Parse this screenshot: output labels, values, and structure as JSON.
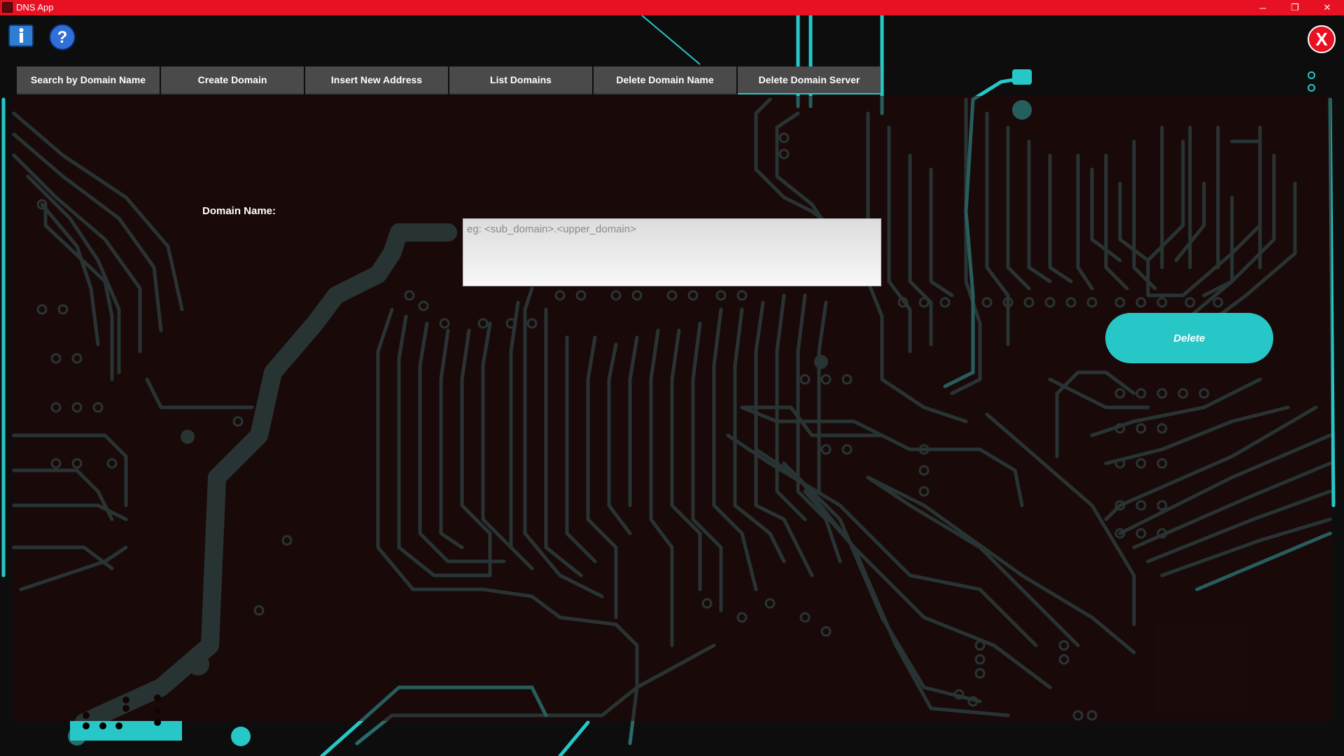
{
  "window": {
    "title": "DNS App",
    "controls": {
      "minimize": "─",
      "maximize": "❐",
      "close": "✕"
    }
  },
  "toolbar": {
    "info_icon": "info-icon",
    "help_icon": "help-icon",
    "close_label": "X"
  },
  "tabs": [
    {
      "label": "Search by Domain Name"
    },
    {
      "label": "Create Domain"
    },
    {
      "label": "Insert New Address"
    },
    {
      "label": "List Domains"
    },
    {
      "label": "Delete Domain Name"
    },
    {
      "label": "Delete Domain Server"
    }
  ],
  "active_tab": "Delete Domain Server",
  "form": {
    "domain_label": "Domain Name:",
    "domain_value": "",
    "domain_placeholder": "eg: <sub_domain>.<upper_domain>",
    "delete_label": "Delete"
  },
  "colors": {
    "titlebar": "#e81123",
    "accent": "#27c7c7",
    "trace": "#2a6b6b",
    "panel": "#260808",
    "tab": "#4a4a4a"
  }
}
